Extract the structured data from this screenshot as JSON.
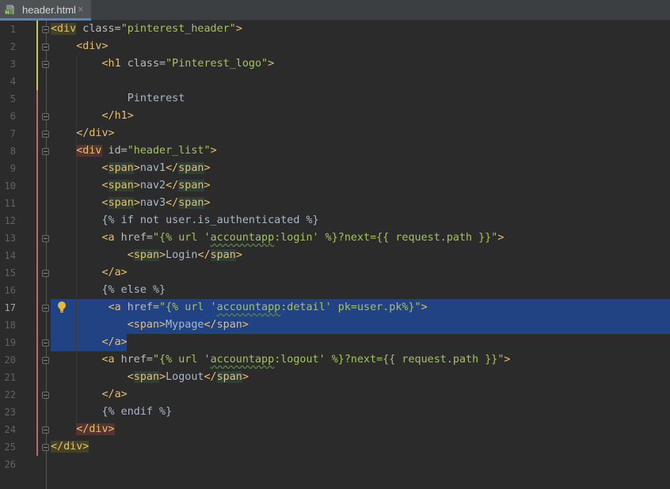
{
  "tab": {
    "title": "header.html",
    "close": "×",
    "icon": "html-file-icon"
  },
  "editor": {
    "current_line": 17,
    "selection_color": "#214283",
    "lines": [
      {
        "n": "1",
        "parts": [
          [
            "tag hlo",
            "<div"
          ],
          [
            "attr",
            " class="
          ],
          [
            "str",
            "\"pinterest_header\""
          ],
          [
            "tag",
            ">"
          ]
        ]
      },
      {
        "n": "2",
        "parts": [
          [
            "",
            "    "
          ],
          [
            "tag",
            "<div>"
          ]
        ]
      },
      {
        "n": "3",
        "parts": [
          [
            "",
            "        "
          ],
          [
            "tag",
            "<h1"
          ],
          [
            "attr",
            " class="
          ],
          [
            "str",
            "\"Pinterest_logo\""
          ],
          [
            "tag",
            ">"
          ]
        ]
      },
      {
        "n": "4",
        "parts": []
      },
      {
        "n": "5",
        "parts": [
          [
            "",
            "            Pinterest"
          ]
        ]
      },
      {
        "n": "6",
        "parts": [
          [
            "",
            "        "
          ],
          [
            "tag",
            "</h1>"
          ]
        ]
      },
      {
        "n": "7",
        "parts": [
          [
            "",
            "    "
          ],
          [
            "tag",
            "</div>"
          ]
        ]
      },
      {
        "n": "8",
        "parts": [
          [
            "",
            "    "
          ],
          [
            "tag hlr",
            "<div"
          ],
          [
            "attr",
            " id="
          ],
          [
            "str",
            "\"header_list\""
          ],
          [
            "tag",
            ">"
          ]
        ]
      },
      {
        "n": "9",
        "parts": [
          [
            "",
            "        "
          ],
          [
            "tag",
            "<"
          ],
          [
            "tag hl",
            "span"
          ],
          [
            "tag",
            ">"
          ],
          [
            "",
            "nav1"
          ],
          [
            "tag",
            "</"
          ],
          [
            "tag hl",
            "span"
          ],
          [
            "tag",
            ">"
          ]
        ]
      },
      {
        "n": "10",
        "parts": [
          [
            "",
            "        "
          ],
          [
            "tag",
            "<"
          ],
          [
            "tag hl",
            "span"
          ],
          [
            "tag",
            ">"
          ],
          [
            "",
            "nav2"
          ],
          [
            "tag",
            "</"
          ],
          [
            "tag hl",
            "span"
          ],
          [
            "tag",
            ">"
          ]
        ]
      },
      {
        "n": "11",
        "parts": [
          [
            "",
            "        "
          ],
          [
            "tag",
            "<"
          ],
          [
            "tag hl",
            "span"
          ],
          [
            "tag",
            ">"
          ],
          [
            "",
            "nav3"
          ],
          [
            "tag",
            "</"
          ],
          [
            "tag hl",
            "span"
          ],
          [
            "tag",
            ">"
          ]
        ]
      },
      {
        "n": "12",
        "parts": [
          [
            "",
            "        "
          ],
          [
            "tpl",
            "{% if not user.is_authenticated %}"
          ]
        ]
      },
      {
        "n": "13",
        "parts": [
          [
            "",
            "        "
          ],
          [
            "tag",
            "<a"
          ],
          [
            "attr",
            " href="
          ],
          [
            "str",
            "\"{% url '"
          ],
          [
            "str wavy",
            "accountapp"
          ],
          [
            "str",
            ":login' %}?next={{ request.path }}\""
          ],
          [
            "tag",
            ">"
          ]
        ]
      },
      {
        "n": "14",
        "parts": [
          [
            "",
            "            "
          ],
          [
            "tag",
            "<"
          ],
          [
            "tag hl",
            "span"
          ],
          [
            "tag",
            ">"
          ],
          [
            "",
            "Login"
          ],
          [
            "tag",
            "</"
          ],
          [
            "tag hl",
            "span"
          ],
          [
            "tag",
            ">"
          ]
        ]
      },
      {
        "n": "15",
        "parts": [
          [
            "",
            "        "
          ],
          [
            "tag",
            "</a>"
          ]
        ]
      },
      {
        "n": "16",
        "parts": [
          [
            "",
            "        "
          ],
          [
            "tpl",
            "{% else %}"
          ]
        ]
      },
      {
        "n": "17",
        "parts": [
          [
            "",
            "         "
          ],
          [
            "tag",
            "<a"
          ],
          [
            "attr",
            " href="
          ],
          [
            "str",
            "\"{% url '"
          ],
          [
            "str wavy",
            "accountapp"
          ],
          [
            "str",
            ":detail' pk=user.pk%}\""
          ],
          [
            "tag",
            ">"
          ]
        ]
      },
      {
        "n": "18",
        "parts": [
          [
            "",
            "            "
          ],
          [
            "tag",
            "<span>"
          ],
          [
            "",
            "Mypage"
          ],
          [
            "tag",
            "</span>"
          ]
        ]
      },
      {
        "n": "19",
        "parts": [
          [
            "",
            "        "
          ],
          [
            "tag",
            "</a>"
          ]
        ]
      },
      {
        "n": "20",
        "parts": [
          [
            "",
            "        "
          ],
          [
            "tag",
            "<a"
          ],
          [
            "attr",
            " href="
          ],
          [
            "str",
            "\"{% url '"
          ],
          [
            "str wavy",
            "accountapp"
          ],
          [
            "str",
            ":logout' %}?next={{ request.path }}\""
          ],
          [
            "tag",
            ">"
          ]
        ]
      },
      {
        "n": "21",
        "parts": [
          [
            "",
            "            "
          ],
          [
            "tag",
            "<"
          ],
          [
            "tag hl",
            "span"
          ],
          [
            "tag",
            ">"
          ],
          [
            "",
            "Logout"
          ],
          [
            "tag",
            "</"
          ],
          [
            "tag hl",
            "span"
          ],
          [
            "tag",
            ">"
          ]
        ]
      },
      {
        "n": "22",
        "parts": [
          [
            "",
            "        "
          ],
          [
            "tag",
            "</a>"
          ]
        ]
      },
      {
        "n": "23",
        "parts": [
          [
            "",
            "        "
          ],
          [
            "tpl",
            "{% endif %}"
          ]
        ]
      },
      {
        "n": "24",
        "parts": [
          [
            "",
            "    "
          ],
          [
            "tag hlr",
            "</div>"
          ]
        ]
      },
      {
        "n": "25",
        "parts": [
          [
            "tag hlo",
            "</div>"
          ]
        ]
      },
      {
        "n": "26",
        "parts": []
      }
    ]
  }
}
